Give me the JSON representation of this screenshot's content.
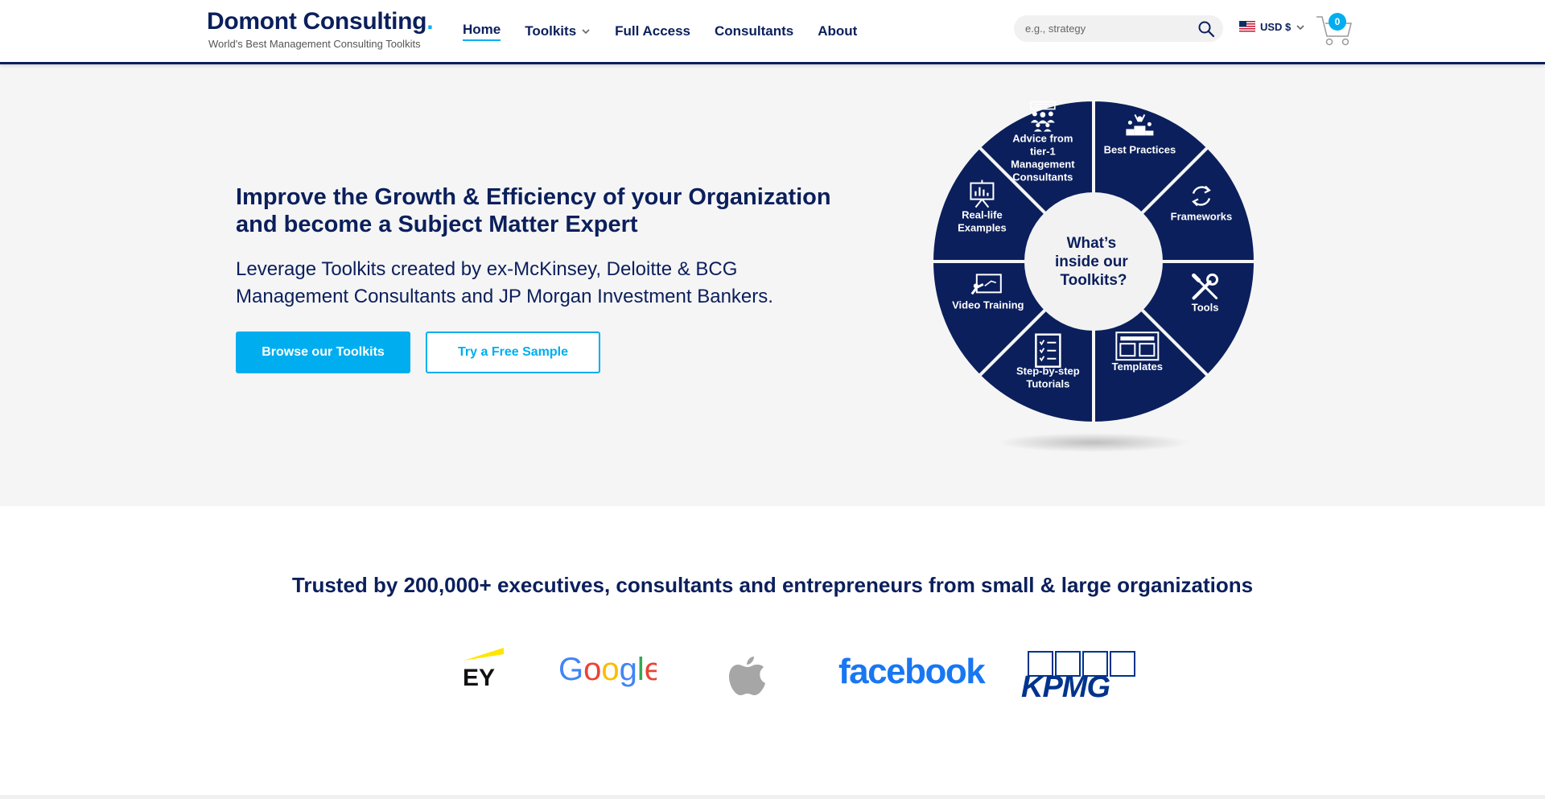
{
  "brand": {
    "name": "Domont Consulting",
    "dot": ".",
    "tagline": "World's Best Management Consulting Toolkits"
  },
  "nav": {
    "items": [
      {
        "label": "Home",
        "active": true
      },
      {
        "label": "Toolkits",
        "dropdown": true
      },
      {
        "label": "Full Access"
      },
      {
        "label": "Consultants"
      },
      {
        "label": "About"
      }
    ]
  },
  "search": {
    "placeholder": "e.g., strategy",
    "icon": "search-icon"
  },
  "currency": {
    "label": "USD $",
    "flag": "us-flag-icon"
  },
  "cart": {
    "count": "0"
  },
  "hero": {
    "title": "Improve the Growth & Efficiency of your Organization and become a Subject Matter Expert",
    "subtitle": "Leverage Toolkits created by ex-McKinsey, Deloitte & BCG Management Consultants and JP Morgan Investment Bankers.",
    "primary_button": "Browse our Toolkits",
    "secondary_button": "Try a Free Sample"
  },
  "wheel": {
    "center": [
      "What’s",
      "inside our",
      "Toolkits?"
    ],
    "segments": [
      {
        "label": [
          "Best Practices"
        ],
        "icon": "podium-icon"
      },
      {
        "label": [
          "Frameworks"
        ],
        "icon": "refresh-cycle-icon"
      },
      {
        "label": [
          "Tools"
        ],
        "icon": "wrench-screwdriver-icon"
      },
      {
        "label": [
          "Templates"
        ],
        "icon": "layout-template-icon"
      },
      {
        "label": [
          "Step-by-step",
          "Tutorials"
        ],
        "icon": "checklist-icon"
      },
      {
        "label": [
          "Video Training"
        ],
        "icon": "presentation-board-icon"
      },
      {
        "label": [
          "Real-life",
          "Examples"
        ],
        "icon": "chart-easel-icon"
      },
      {
        "label": [
          "Advice from",
          "tier-1",
          "Management",
          "Consultants"
        ],
        "icon": "team-icon"
      }
    ],
    "color": "#0b1f5c"
  },
  "trusted": {
    "heading": "Trusted by 200,000+ executives, consultants and entrepreneurs from small & large organizations",
    "logos": [
      {
        "name": "EY",
        "text": "EY"
      },
      {
        "name": "Google",
        "text": "Google"
      },
      {
        "name": "Apple",
        "text": ""
      },
      {
        "name": "facebook",
        "text": "facebook"
      },
      {
        "name": "KPMG",
        "text": "KPMG"
      }
    ]
  },
  "colors": {
    "navy": "#0b1f5c",
    "accent": "#00aeef",
    "hero_bg": "#f5f5f5"
  }
}
